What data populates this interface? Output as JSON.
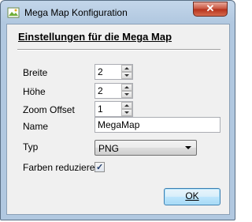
{
  "window": {
    "title": "Mega Map Konfiguration",
    "close_symbol": "✕"
  },
  "form": {
    "heading": "Einstellungen für die Mega Map",
    "breite_label": "Breite",
    "breite_value": "2",
    "hoehe_label": "Höhe",
    "hoehe_value": "2",
    "zoom_label": "Zoom Offset",
    "zoom_value": "1",
    "name_label": "Name",
    "name_value": "MegaMap",
    "typ_label": "Typ",
    "typ_value": "PNG",
    "farben_label": "Farben reduzieren",
    "farben_checked": true,
    "ok_label": "OK"
  },
  "icons": {
    "app": "app-icon",
    "close": "close-icon",
    "spin_up": "chevron-up-icon",
    "spin_down": "chevron-down-icon",
    "dropdown": "dropdown-arrow-icon",
    "check": "checkmark-icon"
  }
}
